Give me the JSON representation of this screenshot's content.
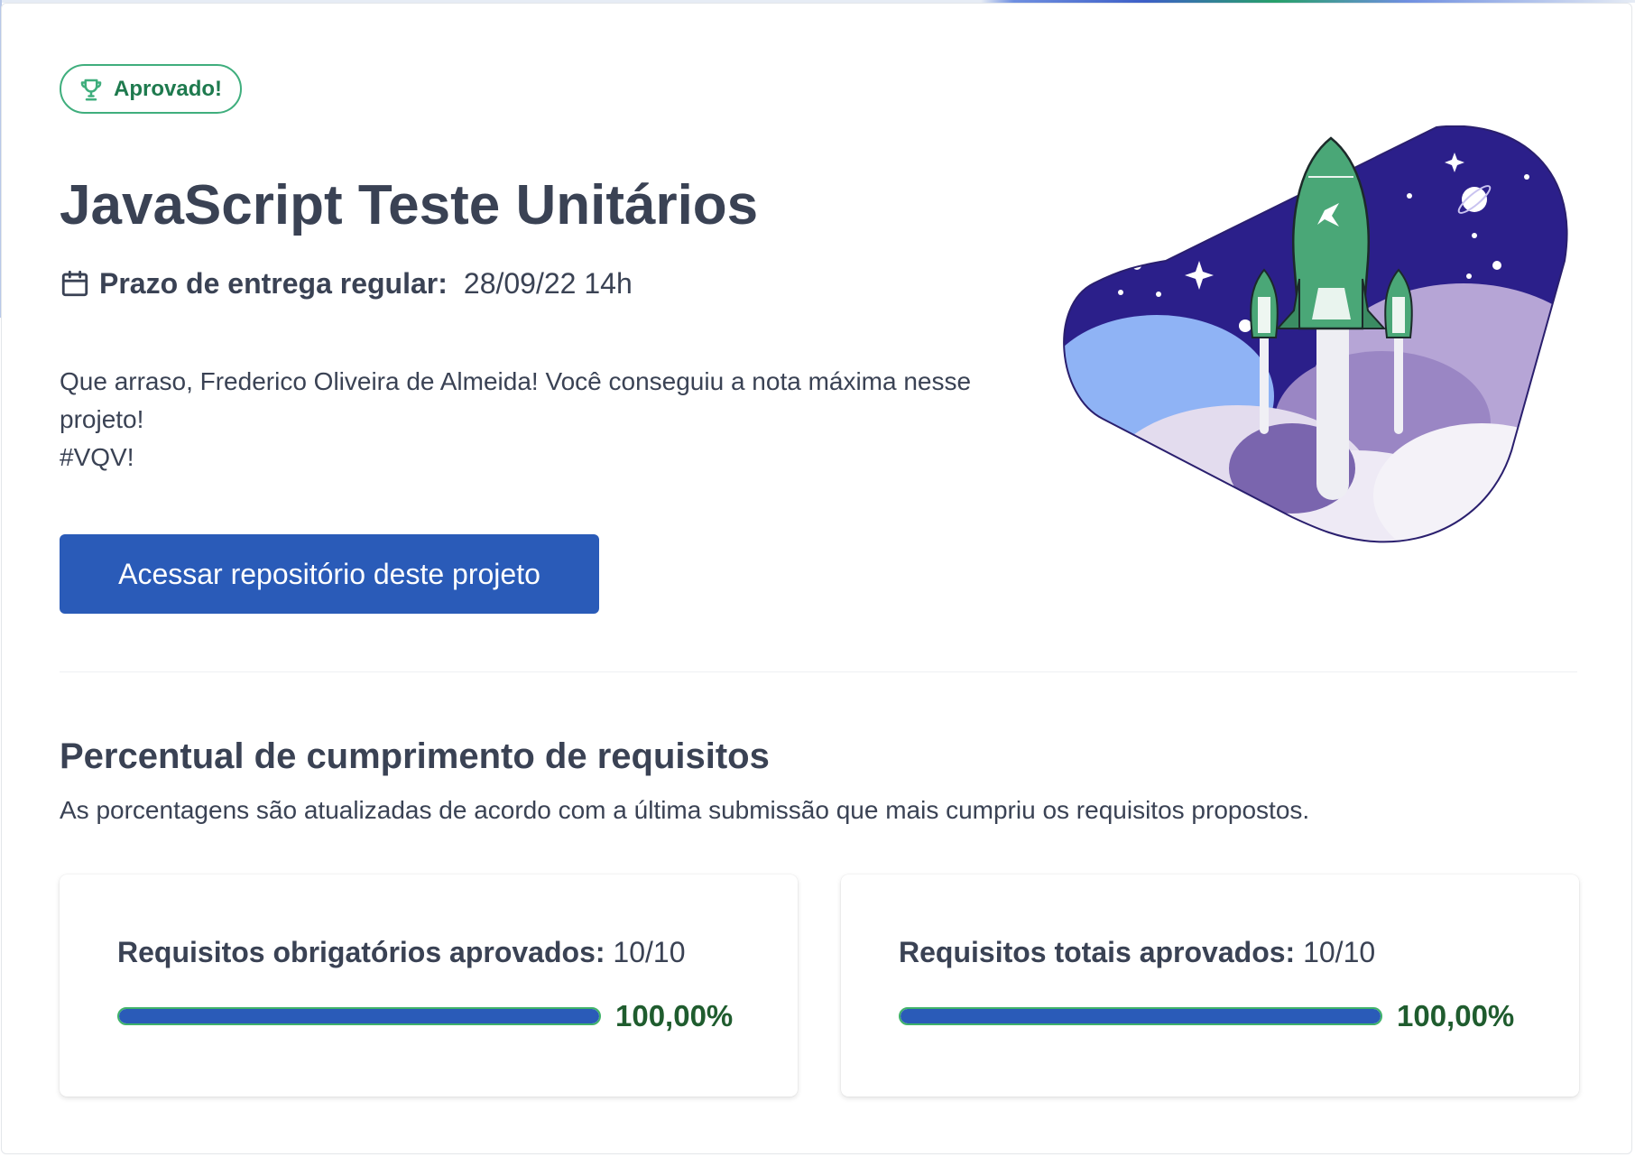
{
  "badge": {
    "label": "Aprovado!",
    "icon": "trophy-icon"
  },
  "project": {
    "title": "JavaScript Teste Unitários",
    "deadline_label": "Prazo de entrega regular:",
    "deadline_value": "28/09/22 14h"
  },
  "message": {
    "line1": "Que arraso, Frederico Oliveira de Almeida! Você conseguiu a nota máxima nesse",
    "line2": "projeto!",
    "line3": "#VQV!"
  },
  "repo_button": {
    "label": "Acessar repositório deste projeto"
  },
  "requirements": {
    "title": "Percentual de cumprimento de requisitos",
    "subtitle": "As porcentagens são atualizadas de acordo com a última submissão que mais cumpriu os requisitos propostos.",
    "cards": [
      {
        "label": "Requisitos obrigatórios aprovados:",
        "count": " 10/10",
        "percent_text": "100,00%",
        "progress": 1.0
      },
      {
        "label": "Requisitos totais aprovados:",
        "count": " 10/10",
        "percent_text": "100,00%",
        "progress": 1.0
      }
    ]
  },
  "colors": {
    "accent": "#2a5bb8",
    "badge_green": "#3fae7d",
    "percent_green": "#1f5c2e",
    "sky": "#2b1f8a",
    "rocket": "#3fae7d"
  },
  "illustration": {
    "icon": "rocket-launch-illustration"
  }
}
